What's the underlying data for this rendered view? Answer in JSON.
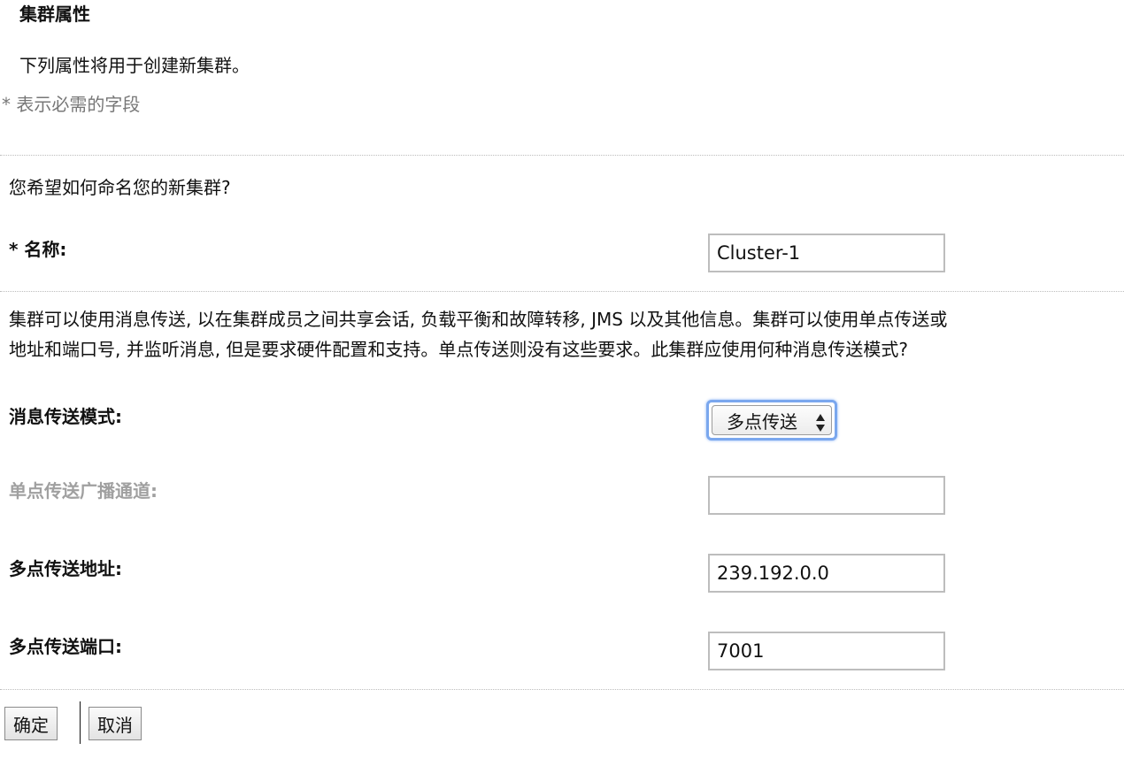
{
  "section": {
    "title": "集群属性",
    "intro": "下列属性将用于创建新集群。",
    "required_note": "* 表示必需的字段"
  },
  "naming": {
    "question": "您希望如何命名您的新集群?",
    "name_label": "* 名称:",
    "name_value": "Cluster-1"
  },
  "messaging": {
    "description_line1": "集群可以使用消息传送, 以在集群成员之间共享会话, 负载平衡和故障转移, JMS 以及其他信息。集群可以使用单点传送或",
    "description_line2": "地址和端口号, 并监听消息, 但是要求硬件配置和支持。单点传送则没有这些要求。此集群应使用何种消息传送模式?",
    "mode_label": "消息传送模式:",
    "mode_value": "多点传送",
    "unicast_channel_label": "单点传送广播通道:",
    "unicast_channel_value": "",
    "multicast_address_label": "多点传送地址:",
    "multicast_address_value": "239.192.0.0",
    "multicast_port_label": "多点传送端口:",
    "multicast_port_value": "7001"
  },
  "buttons": {
    "ok": "确定",
    "cancel": "取消"
  }
}
